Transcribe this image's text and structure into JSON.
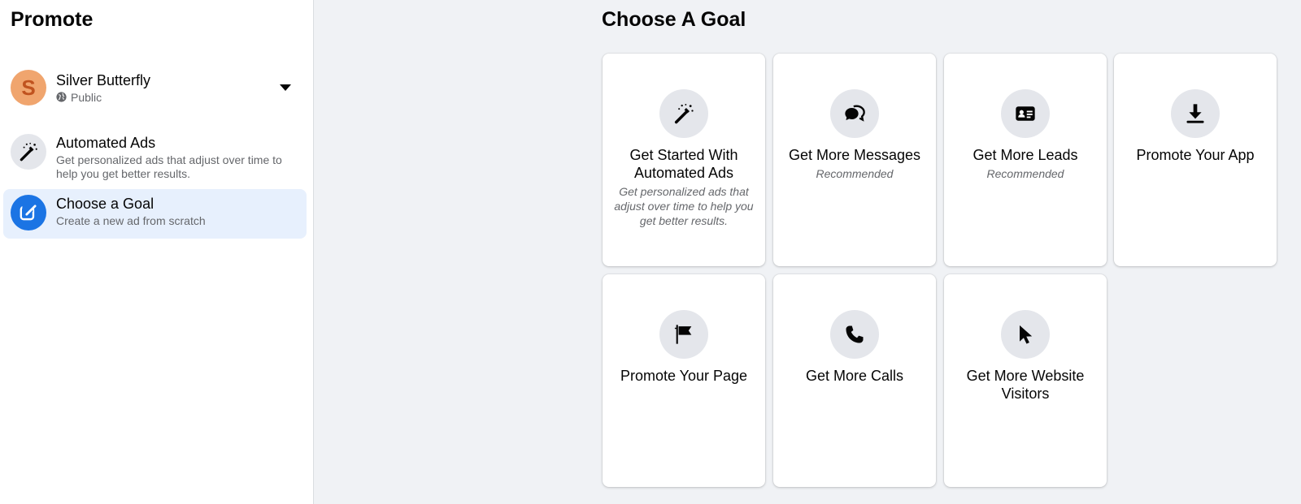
{
  "sidebar": {
    "title": "Promote",
    "account": {
      "initial": "S",
      "name": "Silver Butterfly",
      "privacy": "Public",
      "avatar_bg": "#f0a56e",
      "avatar_fg": "#c0531f"
    },
    "items": [
      {
        "icon": "magic-wand-icon",
        "title": "Automated Ads",
        "description": "Get personalized ads that adjust over time to help you get better results."
      },
      {
        "icon": "edit-icon",
        "title": "Choose a Goal",
        "description": "Create a new ad from scratch",
        "selected": true
      }
    ]
  },
  "main": {
    "title": "Choose A Goal",
    "goals": [
      {
        "icon": "magic-wand-icon",
        "title": "Get Started With Automated Ads",
        "subtitle": "Get personalized ads that adjust over time to help you get better results."
      },
      {
        "icon": "messages-icon",
        "title": "Get More Messages",
        "subtitle": "Recommended"
      },
      {
        "icon": "lead-card-icon",
        "title": "Get More Leads",
        "subtitle": "Recommended"
      },
      {
        "icon": "download-icon",
        "title": "Promote Your App",
        "subtitle": ""
      },
      {
        "icon": "flag-icon",
        "title": "Promote Your Page",
        "subtitle": ""
      },
      {
        "icon": "phone-icon",
        "title": "Get More Calls",
        "subtitle": ""
      },
      {
        "icon": "cursor-icon",
        "title": "Get More Website Visitors",
        "subtitle": ""
      }
    ]
  },
  "colors": {
    "page_bg": "#f0f2f5",
    "accent_blue": "#1b74e4",
    "selected_bg": "#e7f0fd",
    "secondary_text": "#65676b"
  }
}
